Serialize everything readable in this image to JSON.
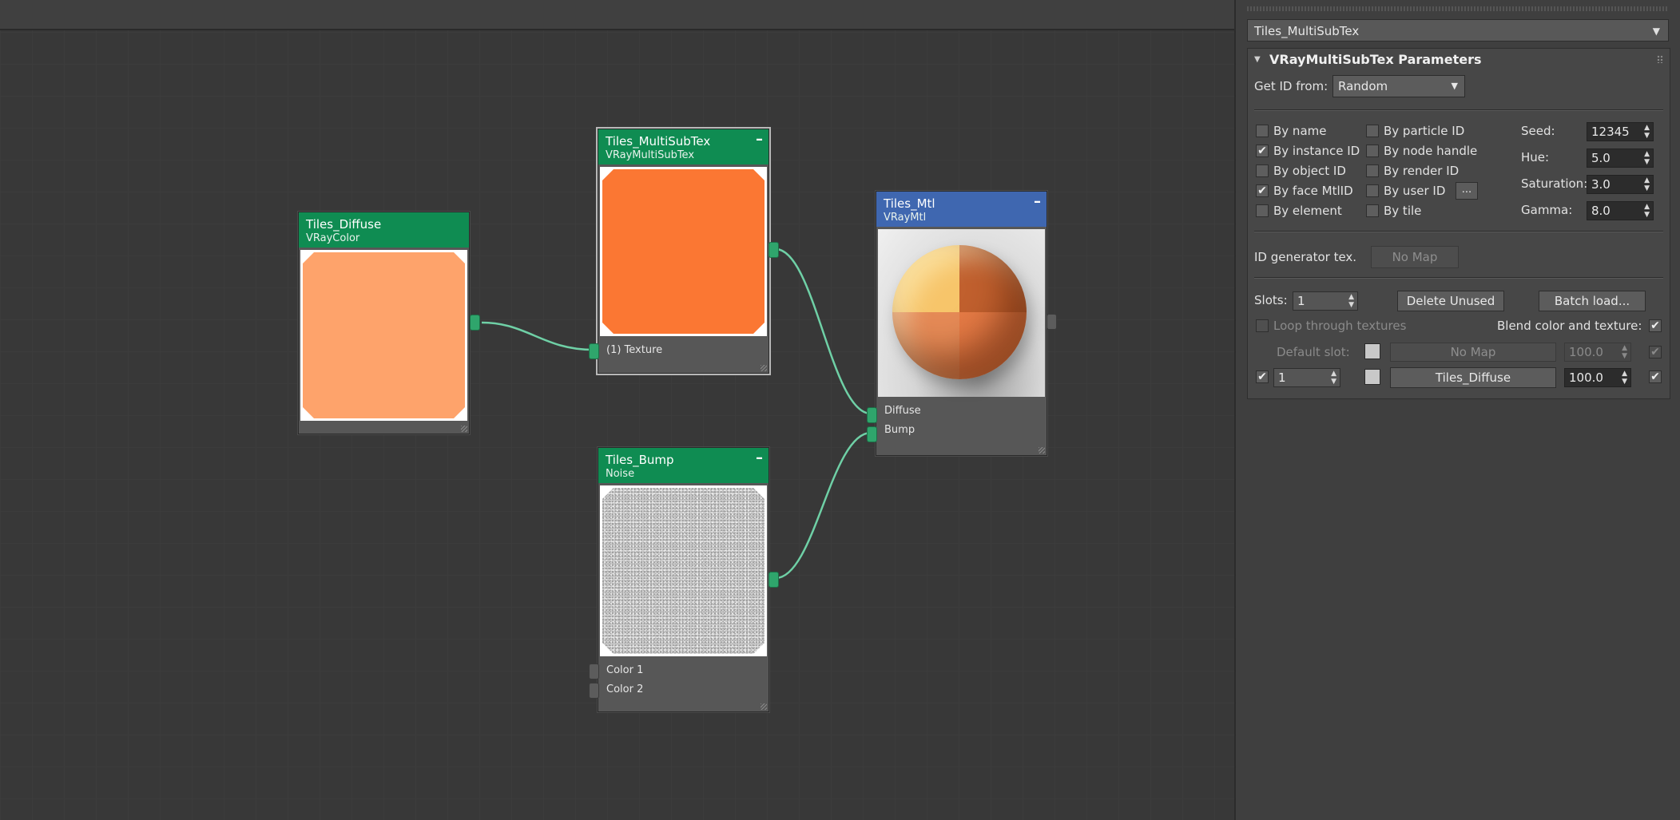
{
  "nodes": {
    "diffuse": {
      "title": "Tiles_Diffuse",
      "subtitle": "VRayColor",
      "color": "#fea36b"
    },
    "multisub": {
      "title": "Tiles_MultiSubTex",
      "subtitle": "VRayMultiSubTex",
      "slot": "(1) Texture",
      "color": "#fb7733"
    },
    "mtl": {
      "title": "Tiles_Mtl",
      "subtitle": "VRayMtl",
      "slots": [
        "Diffuse",
        "Bump"
      ]
    },
    "bump": {
      "title": "Tiles_Bump",
      "subtitle": "Noise",
      "slots": [
        "Color 1",
        "Color 2"
      ]
    }
  },
  "panel": {
    "material_name": "Tiles_MultiSubTex",
    "rollout_title": "VRayMultiSubTex Parameters",
    "get_id_label": "Get ID from:",
    "get_id_value": "Random",
    "options": [
      {
        "label": "By name",
        "checked": false
      },
      {
        "label": "By particle ID",
        "checked": false
      },
      {
        "label": "By instance ID",
        "checked": true
      },
      {
        "label": "By node handle",
        "checked": false
      },
      {
        "label": "By object ID",
        "checked": false
      },
      {
        "label": "By render ID",
        "checked": false
      },
      {
        "label": "By face MtlID",
        "checked": true
      },
      {
        "label": "By user ID",
        "checked": false
      },
      {
        "label": "By element",
        "checked": false
      },
      {
        "label": "By tile",
        "checked": false
      }
    ],
    "user_id_button": "...",
    "seed_label": "Seed:",
    "seed_value": "12345",
    "hue_label": "Hue:",
    "hue_value": "5.0",
    "saturation_label": "Saturation:",
    "saturation_value": "3.0",
    "gamma_label": "Gamma:",
    "gamma_value": "8.0",
    "id_gen_label": "ID generator tex.",
    "id_gen_button": "No Map",
    "slots_label": "Slots:",
    "slots_value": "1",
    "delete_unused": "Delete Unused",
    "batch_load": "Batch load...",
    "loop_label": "Loop through textures",
    "blend_label": "Blend color and texture:",
    "blend_checked": true,
    "default_slot_label": "Default slot:",
    "default_slot_map": "No Map",
    "default_slot_amount": "100.0",
    "slot_row": {
      "index": "1",
      "map": "Tiles_Diffuse",
      "amount": "100.0"
    },
    "check_mark": "✔"
  }
}
